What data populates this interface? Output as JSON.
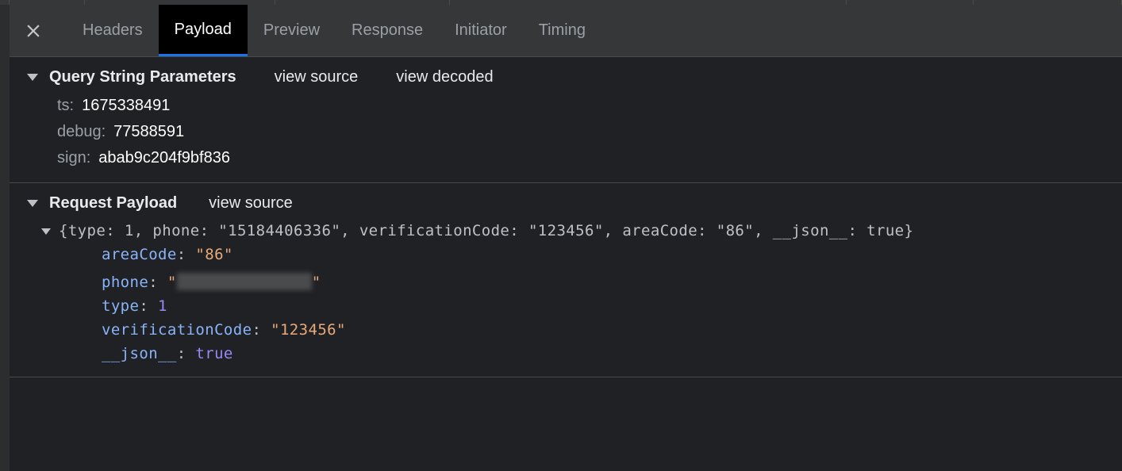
{
  "tabs": {
    "headers": "Headers",
    "payload": "Payload",
    "preview": "Preview",
    "response": "Response",
    "initiator": "Initiator",
    "timing": "Timing"
  },
  "section1": {
    "title": "Query String Parameters",
    "view_source": "view source",
    "view_decoded": "view decoded",
    "params": {
      "ts_key": "ts:",
      "ts_val": "1675338491",
      "debug_key": "debug:",
      "debug_val": "77588591",
      "sign_key": "sign:",
      "sign_val": "abab9c204f9bf836"
    }
  },
  "section2": {
    "title": "Request Payload",
    "view_source": "view source",
    "summary": "{type: 1, phone: \"15184406336\", verificationCode: \"123456\", areaCode: \"86\", __json__: true}",
    "props": {
      "areaCode_key": "areaCode",
      "areaCode_val": "\"86\"",
      "phone_key": "phone",
      "type_key": "type",
      "type_val": "1",
      "verificationCode_key": "verificationCode",
      "verificationCode_val": "\"123456\"",
      "json_key": "__json__",
      "json_val": "true"
    }
  }
}
